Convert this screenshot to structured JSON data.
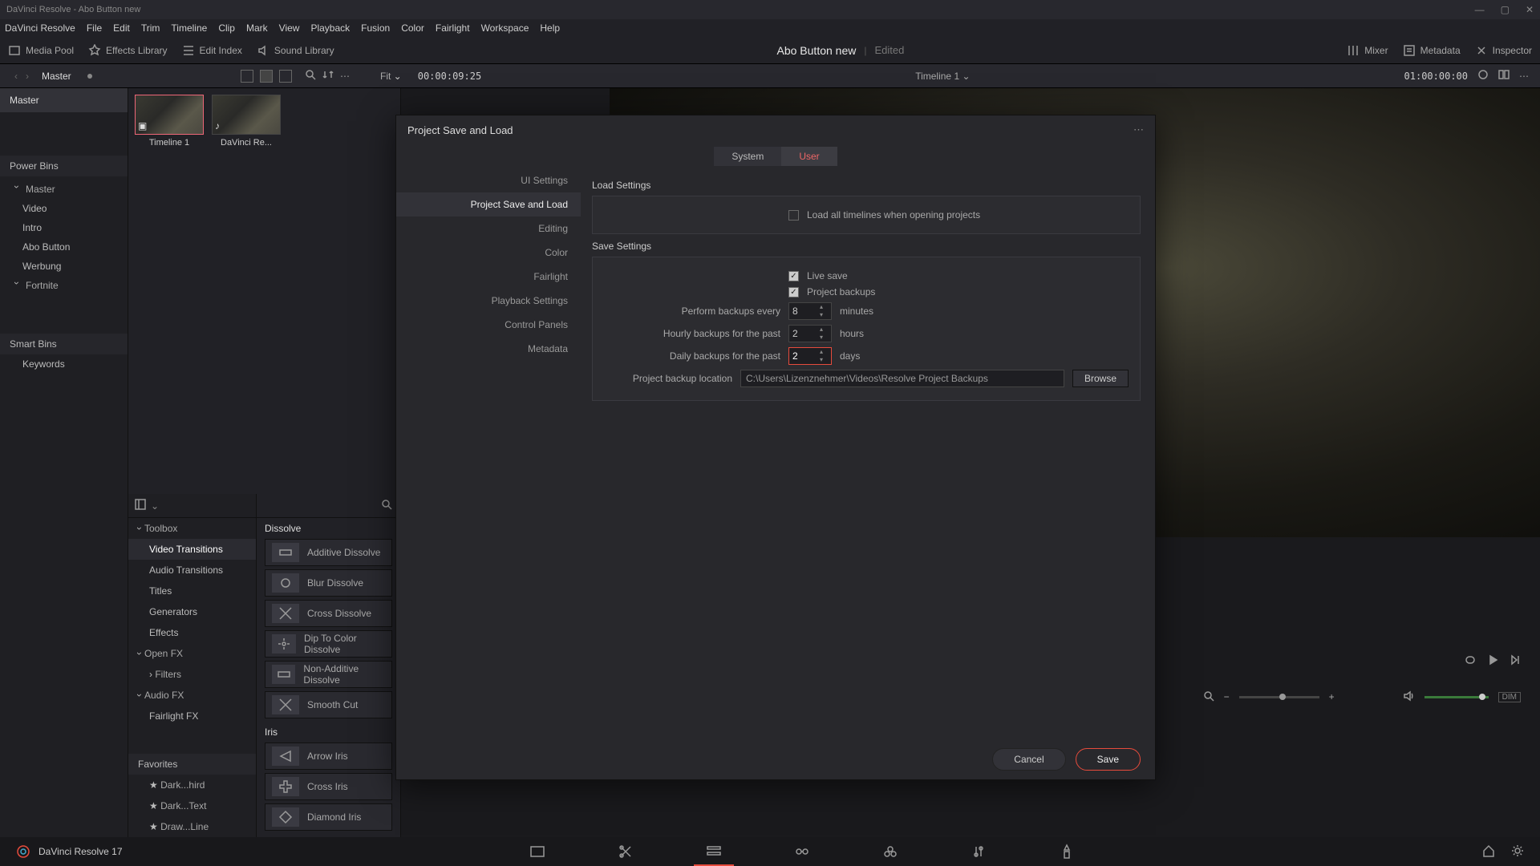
{
  "window": {
    "title": "DaVinci Resolve - Abo Button new"
  },
  "menus": [
    "DaVinci Resolve",
    "File",
    "Edit",
    "Trim",
    "Timeline",
    "Clip",
    "Mark",
    "View",
    "Playback",
    "Fusion",
    "Color",
    "Fairlight",
    "Workspace",
    "Help"
  ],
  "toolbar": {
    "media_pool": "Media Pool",
    "effects_library": "Effects Library",
    "edit_index": "Edit Index",
    "sound_library": "Sound Library",
    "mixer": "Mixer",
    "metadata": "Metadata",
    "inspector": "Inspector"
  },
  "project": {
    "title": "Abo Button new",
    "status": "Edited"
  },
  "toolbar2": {
    "master": "Master",
    "fit": "Fit",
    "timecode_left": "00:00:09:25",
    "timeline_name": "Timeline 1",
    "timecode_right": "01:00:00:00"
  },
  "sidebar_master": {
    "head": "Master",
    "power_bins": "Power Bins",
    "items": [
      "Video",
      "Intro",
      "Abo Button",
      "Werbung",
      "Fortnite"
    ],
    "smart_bins": "Smart Bins",
    "keywords": "Keywords"
  },
  "bin": {
    "clips": [
      {
        "name": "Timeline 1"
      },
      {
        "name": "DaVinci Re..."
      }
    ]
  },
  "fx_side": {
    "toolbox": "Toolbox",
    "items": [
      "Video Transitions",
      "Audio Transitions",
      "Titles",
      "Generators",
      "Effects"
    ],
    "openfx": "Open FX",
    "filters": "Filters",
    "audiofx": "Audio FX",
    "fairlightfx": "Fairlight FX",
    "favorites": "Favorites",
    "fav_items": [
      "Dark...hird",
      "Dark...Text",
      "Draw...Line"
    ]
  },
  "fx_list": {
    "group_dissolve": "Dissolve",
    "dissolves": [
      "Additive Dissolve",
      "Blur Dissolve",
      "Cross Dissolve",
      "Dip To Color Dissolve",
      "Non-Additive Dissolve",
      "Smooth Cut"
    ],
    "group_iris": "Iris",
    "irises": [
      "Arrow Iris",
      "Cross Iris",
      "Diamond Iris"
    ]
  },
  "viewer": {
    "dim_label": "DIM"
  },
  "app": {
    "name": "DaVinci Resolve 17"
  },
  "dialog": {
    "title": "Project Save and Load",
    "tabs": {
      "system": "System",
      "user": "User"
    },
    "side": [
      "UI Settings",
      "Project Save and Load",
      "Editing",
      "Color",
      "Fairlight",
      "Playback Settings",
      "Control Panels",
      "Metadata"
    ],
    "side_active_index": 1,
    "load_settings_title": "Load Settings",
    "load_all_timelines": "Load all timelines when opening projects",
    "save_settings_title": "Save Settings",
    "live_save": "Live save",
    "project_backups": "Project backups",
    "perform_every_label": "Perform backups every",
    "perform_every_value": "8",
    "perform_every_unit": "minutes",
    "hourly_label": "Hourly backups for the past",
    "hourly_value": "2",
    "hourly_unit": "hours",
    "daily_label": "Daily backups for the past",
    "daily_value": "2",
    "daily_unit": "days",
    "location_label": "Project backup location",
    "location_value": "C:\\Users\\Lizenznehmer\\Videos\\Resolve Project Backups",
    "browse": "Browse",
    "cancel": "Cancel",
    "save": "Save"
  }
}
